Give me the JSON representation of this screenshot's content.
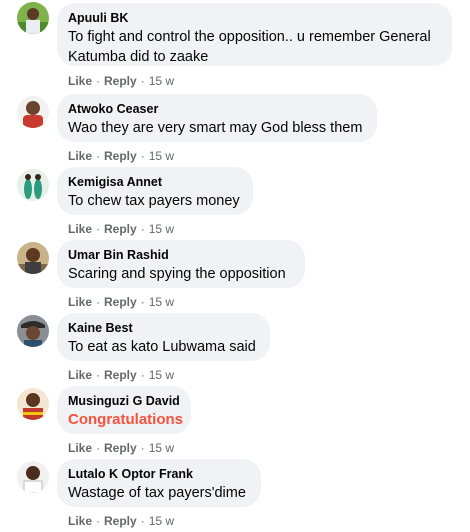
{
  "comments": [
    {
      "author": "Apuuli BK",
      "text": "To fight and control the opposition.. u remember General Katumba did to zaake",
      "like": "Like",
      "reply": "Reply",
      "time": "15 w"
    },
    {
      "author": "Atwoko Ceaser",
      "text": "Wao they are very smart may God bless them",
      "like": "Like",
      "reply": "Reply",
      "time": "15 w"
    },
    {
      "author": "Kemigisa Annet",
      "text": "To chew tax payers money",
      "like": "Like",
      "reply": "Reply",
      "time": "15 w"
    },
    {
      "author": "Umar Bin Rashid",
      "text": "Scaring and spying the opposition",
      "like": "Like",
      "reply": "Reply",
      "time": "15 w"
    },
    {
      "author": "Kaine Best",
      "text": "To eat as kato Lubwama said",
      "like": "Like",
      "reply": "Reply",
      "time": "15 w"
    },
    {
      "author": "Musinguzi G David",
      "text": "Congratulations",
      "like": "Like",
      "reply": "Reply",
      "time": "15 w"
    },
    {
      "author": "Lutalo K Optor Frank",
      "text": "Wastage of tax payers'dime",
      "like": "Like",
      "reply": "Reply",
      "time": "15 w"
    }
  ],
  "separator": "·",
  "colors": {
    "bubble": "#f0f2f5",
    "meta": "#65676b",
    "congrats": "#f5533d"
  }
}
